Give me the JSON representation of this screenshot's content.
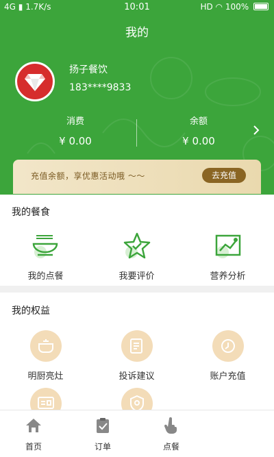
{
  "status_bar": {
    "signal": "4G",
    "speed": "1.7K/s",
    "time": "10:01",
    "hd": "HD",
    "battery": "100%"
  },
  "header": {
    "title": "我的"
  },
  "profile": {
    "name": "扬子餐饮",
    "phone": "183****9833"
  },
  "stats": [
    {
      "label": "消费",
      "value": "¥ 0.00"
    },
    {
      "label": "余额",
      "value": "¥ 0.00"
    }
  ],
  "promo": {
    "text": "充值余额，享优惠活动哦 ～～",
    "button": "去充值"
  },
  "section_meals": {
    "title": "我的餐食",
    "items": [
      {
        "label": "我的点餐",
        "icon": "bowl-icon"
      },
      {
        "label": "我要评价",
        "icon": "star-review-icon"
      },
      {
        "label": "营养分析",
        "icon": "chart-analysis-icon"
      }
    ]
  },
  "section_benefits": {
    "title": "我的权益",
    "items": [
      {
        "label": "明厨亮灶",
        "icon": "kitchen-pot-icon"
      },
      {
        "label": "投诉建议",
        "icon": "complaint-doc-icon"
      },
      {
        "label": "账户充值",
        "icon": "recharge-clock-icon"
      },
      {
        "label": "",
        "icon": "id-card-icon"
      },
      {
        "label": "",
        "icon": "shield-badge-icon"
      }
    ]
  },
  "bottom_nav": [
    {
      "label": "首页",
      "icon": "home-icon"
    },
    {
      "label": "订单",
      "icon": "order-clipboard-icon"
    },
    {
      "label": "点餐",
      "icon": "tap-hand-icon"
    }
  ],
  "colors": {
    "primary": "#3ca53b",
    "accent_gold": "#8a6523",
    "promo_bg": "#efe0bd",
    "icon_bg": "#f3dcb8"
  }
}
